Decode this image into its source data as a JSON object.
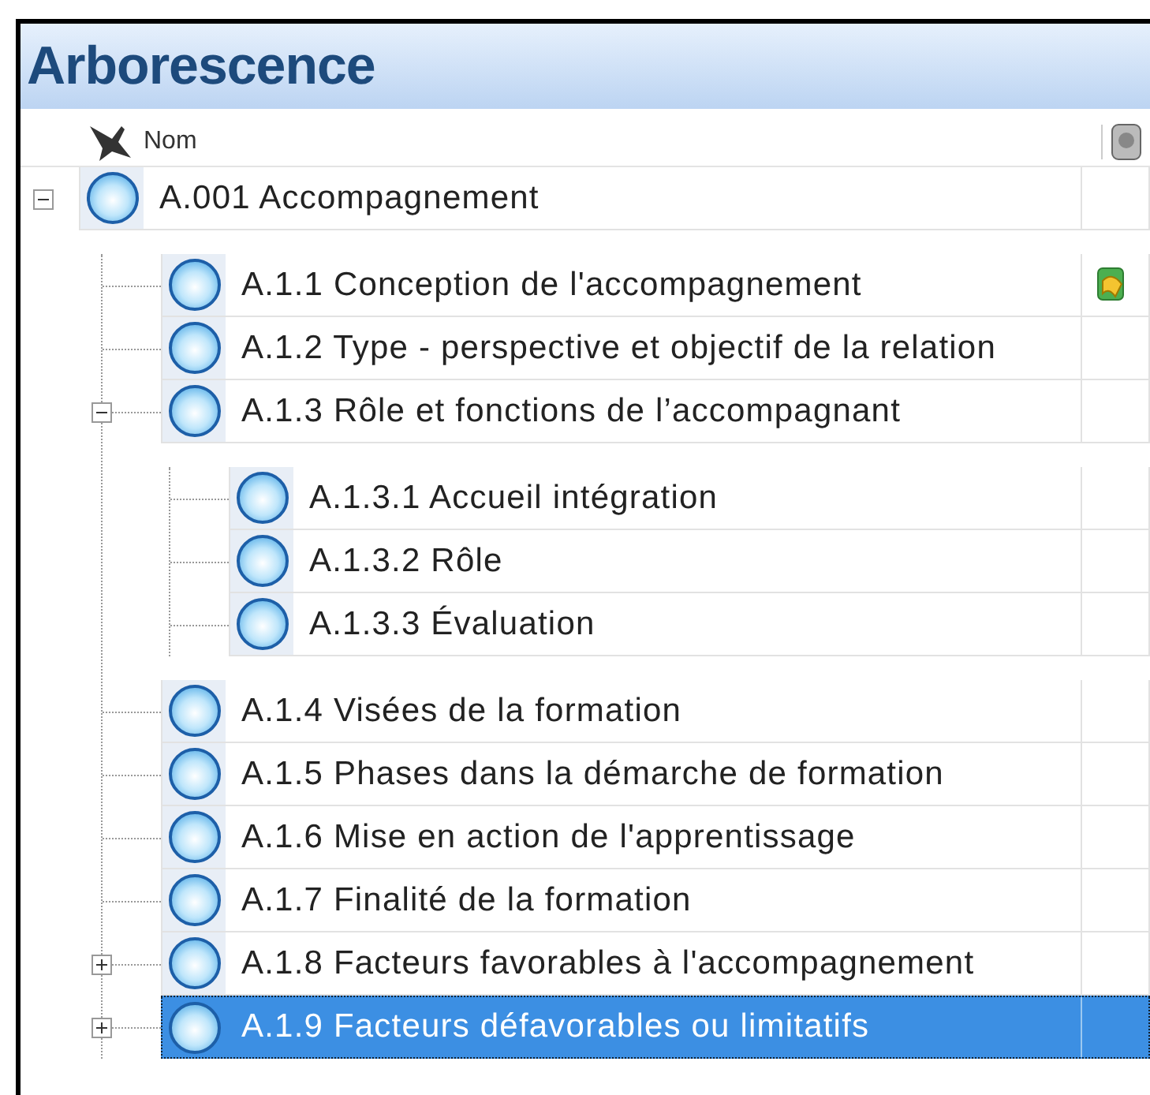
{
  "panel": {
    "title": "Arborescence"
  },
  "header": {
    "column": "Nom"
  },
  "tree": [
    {
      "label": "A.001 Accompagnement",
      "expanded": true,
      "selected": false,
      "linked": false,
      "children": [
        {
          "label": "A.1.1 Conception de l'accompagnement",
          "selected": false,
          "linked": true
        },
        {
          "label": "A.1.2 Type - perspective et objectif de la relation",
          "selected": false,
          "linked": false
        },
        {
          "label": "A.1.3 Rôle et fonctions de l’accompagnant",
          "expanded": true,
          "selected": false,
          "linked": false,
          "children": [
            {
              "label": "A.1.3.1 Accueil intégration",
              "selected": false,
              "linked": false
            },
            {
              "label": "A.1.3.2 Rôle",
              "selected": false,
              "linked": false
            },
            {
              "label": "A.1.3.3 Évaluation",
              "selected": false,
              "linked": false
            }
          ]
        },
        {
          "label": "A.1.4 Visées de la formation",
          "selected": false,
          "linked": false
        },
        {
          "label": "A.1.5 Phases dans la démarche de formation",
          "selected": false,
          "linked": false
        },
        {
          "label": "A.1.6 Mise en action de l'apprentissage",
          "selected": false,
          "linked": false
        },
        {
          "label": "A.1.7 Finalité de la formation",
          "selected": false,
          "linked": false
        },
        {
          "label": "A.1.8 Facteurs favorables à l'accompagnement",
          "expanded": false,
          "selected": false,
          "linked": false
        },
        {
          "label": "A.1.9 Facteurs défavorables ou limitatifs",
          "expanded": false,
          "selected": true,
          "linked": false
        }
      ]
    }
  ]
}
